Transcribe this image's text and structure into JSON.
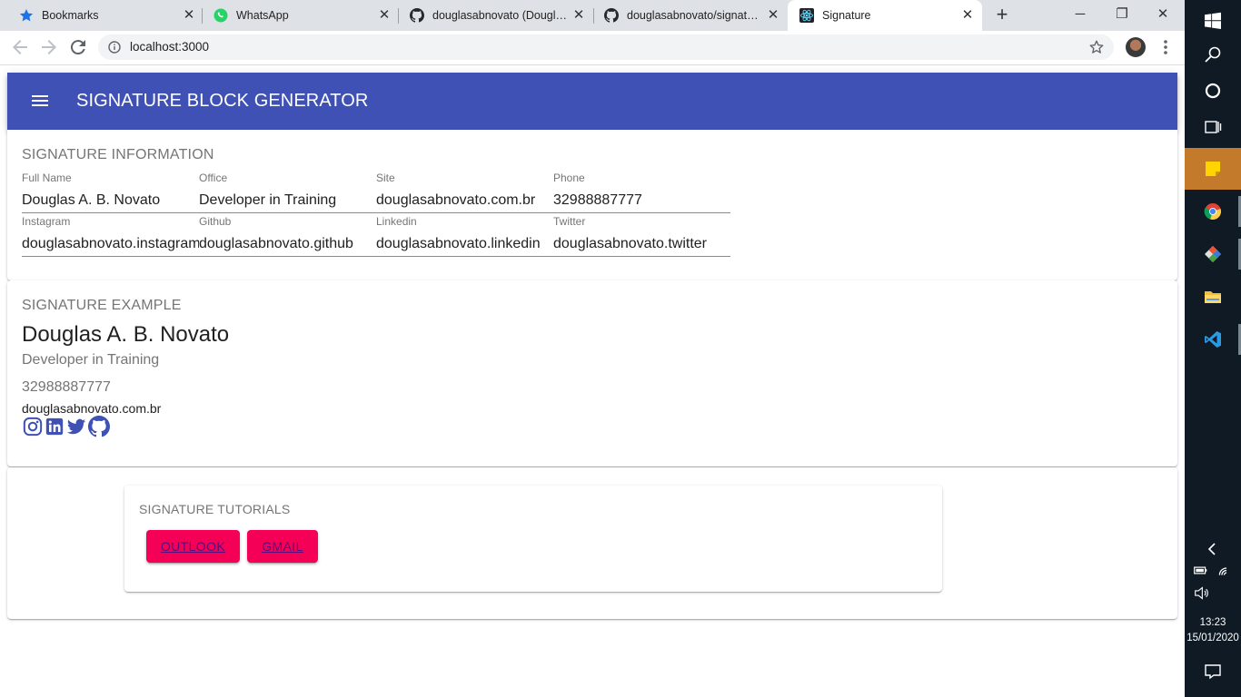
{
  "browser": {
    "tabs": [
      {
        "label": "Bookmarks",
        "icon": "star-icon",
        "active": false
      },
      {
        "label": "WhatsApp",
        "icon": "whatsapp-icon",
        "active": false
      },
      {
        "label": "douglasabnovato (Douglas N",
        "icon": "github-icon",
        "active": false
      },
      {
        "label": "douglasabnovato/signature-",
        "icon": "github-icon",
        "active": false
      },
      {
        "label": "Signature",
        "icon": "react-icon",
        "active": true
      }
    ],
    "url": "localhost:3000"
  },
  "app": {
    "title": "SIGNATURE BLOCK GENERATOR"
  },
  "info": {
    "title": "SIGNATURE INFORMATION",
    "fields": [
      {
        "label": "Full Name",
        "value": "Douglas A. B. Novato"
      },
      {
        "label": "Office",
        "value": "Developer in Training"
      },
      {
        "label": "Site",
        "value": "douglasabnovato.com.br"
      },
      {
        "label": "Phone",
        "value": "32988887777"
      },
      {
        "label": "Instagram",
        "value": "douglasabnovato.instagram"
      },
      {
        "label": "Github",
        "value": "douglasabnovato.github"
      },
      {
        "label": "Linkedin",
        "value": "douglasabnovato.linkedin"
      },
      {
        "label": "Twitter",
        "value": "douglasabnovato.twitter"
      }
    ]
  },
  "example": {
    "title": "SIGNATURE EXAMPLE",
    "name": "Douglas A. B. Novato",
    "office": "Developer in Training",
    "phone": "32988887777",
    "site": "douglasabnovato.com.br",
    "social_icons": [
      "instagram-icon",
      "linkedin-icon",
      "twitter-icon",
      "github-icon"
    ]
  },
  "tutorials": {
    "title": "SIGNATURE TUTORIALS",
    "buttons": [
      "OUTLOOK",
      "GMAIL"
    ]
  },
  "colors": {
    "appbar": "#3f51b5",
    "button": "#f50057",
    "icon": "#3f51b5"
  },
  "taskbar": {
    "time": "13:23",
    "date": "15/01/2020"
  }
}
